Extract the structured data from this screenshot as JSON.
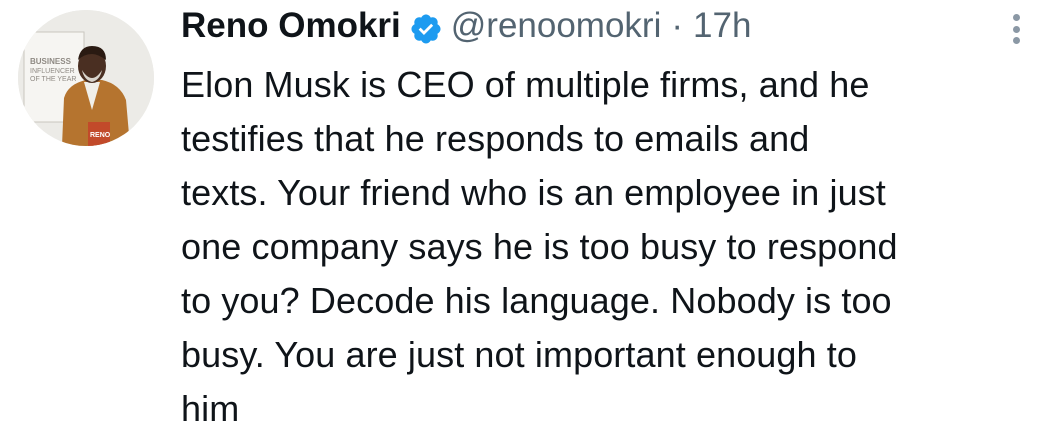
{
  "tweet": {
    "author": {
      "display_name": "Reno Omokri",
      "handle": "@renoomokri",
      "verified_icon": "verified-badge-icon",
      "avatar_badge_lines": [
        "BUSINESS",
        "INFLUENCER",
        "OF THE YEAR"
      ],
      "avatar_signature": "RENO"
    },
    "separator": "·",
    "timestamp": "17h",
    "more_icon": "more-options-icon",
    "text_lines": [
      "Elon Musk is CEO of multiple firms, and he",
      "testifies that he responds to emails and",
      "texts. Your friend who is an employee in just",
      "one company says he is too busy to respond",
      "to you? Decode his language. Nobody is too",
      "busy. You are just not important enough to",
      "him"
    ]
  },
  "colors": {
    "text": "#0f1419",
    "secondary": "#536471",
    "verified": "#1d9bf0",
    "jacket": "#b5742f"
  }
}
